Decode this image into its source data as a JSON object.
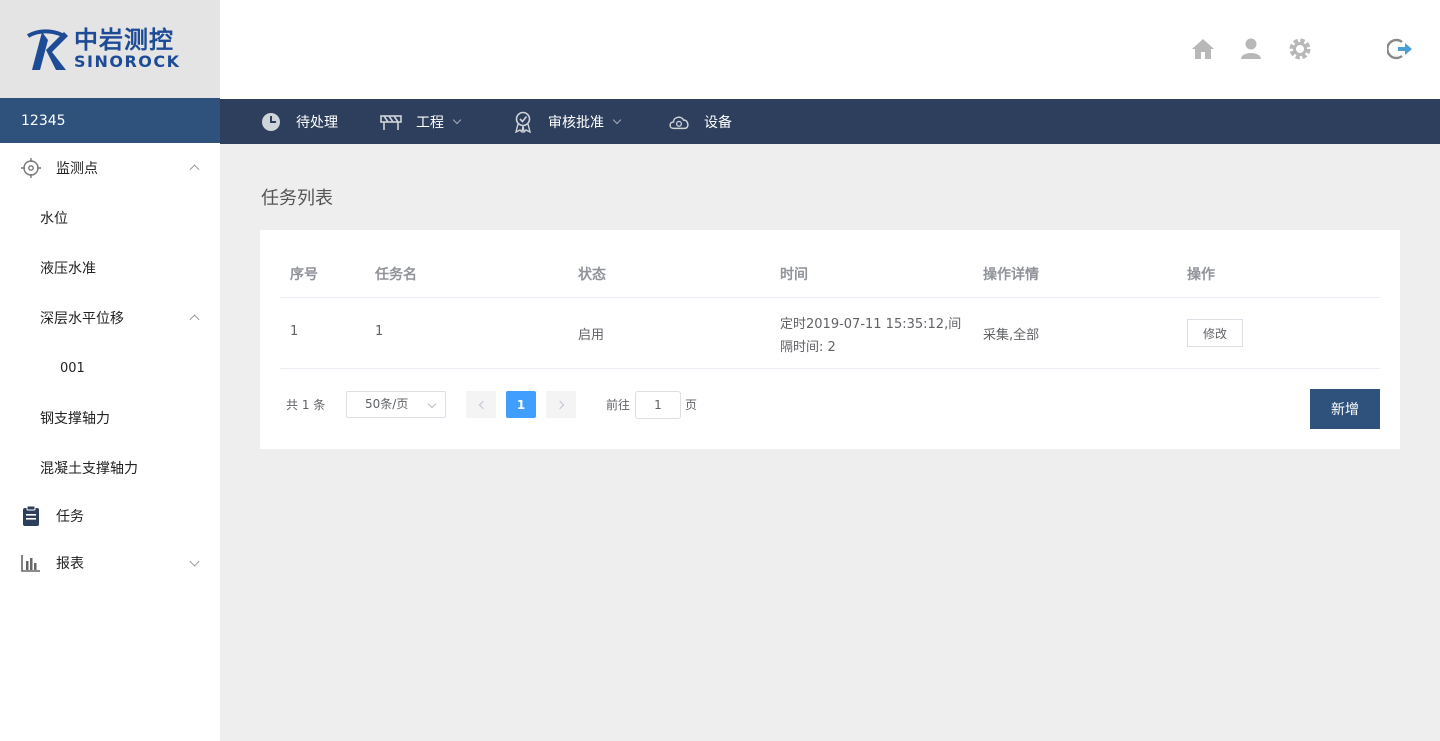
{
  "logo": {
    "cn": "中岩测控",
    "en": "SINOROCK"
  },
  "user": {
    "name": "12345"
  },
  "sidebar": {
    "items": [
      {
        "label": "监测点",
        "icon": "target-icon"
      },
      {
        "label": "水位"
      },
      {
        "label": "液压水准"
      },
      {
        "label": "深层水平位移"
      },
      {
        "label": "001"
      },
      {
        "label": "钢支撑轴力"
      },
      {
        "label": "混凝土支撑轴力"
      },
      {
        "label": "任务",
        "icon": "clipboard-icon"
      },
      {
        "label": "报表",
        "icon": "bar-chart-icon"
      }
    ]
  },
  "header": {
    "icons": [
      "home-icon",
      "user-icon",
      "gear-icon",
      "logout-icon"
    ]
  },
  "nav": {
    "items": [
      {
        "label": "待处理",
        "icon": "clock-icon"
      },
      {
        "label": "工程",
        "icon": "barrier-icon"
      },
      {
        "label": "审核批准",
        "icon": "badge-icon"
      },
      {
        "label": "设备",
        "icon": "cloud-camera-icon"
      }
    ]
  },
  "main": {
    "title": "任务列表",
    "table": {
      "headers": [
        "序号",
        "任务名",
        "状态",
        "时间",
        "操作详情",
        "操作"
      ],
      "rows": [
        {
          "index": "1",
          "name": "1",
          "status": "启用",
          "time_line1": "定时2019-07-11 15:35:12,间",
          "time_line2": "隔时间: 2",
          "detail": "采集,全部",
          "action": "修改"
        }
      ]
    },
    "pagination": {
      "total": "共 1 条",
      "page_size": "50条/页",
      "current_page": "1",
      "goto_label": "前往",
      "goto_value": "1",
      "page_suffix": "页"
    },
    "add_button": "新增"
  },
  "colors": {
    "accent": "#2e527c",
    "nav_bg": "#2d3f5c",
    "page_active": "#409eff",
    "brand": "#1d4b96"
  }
}
